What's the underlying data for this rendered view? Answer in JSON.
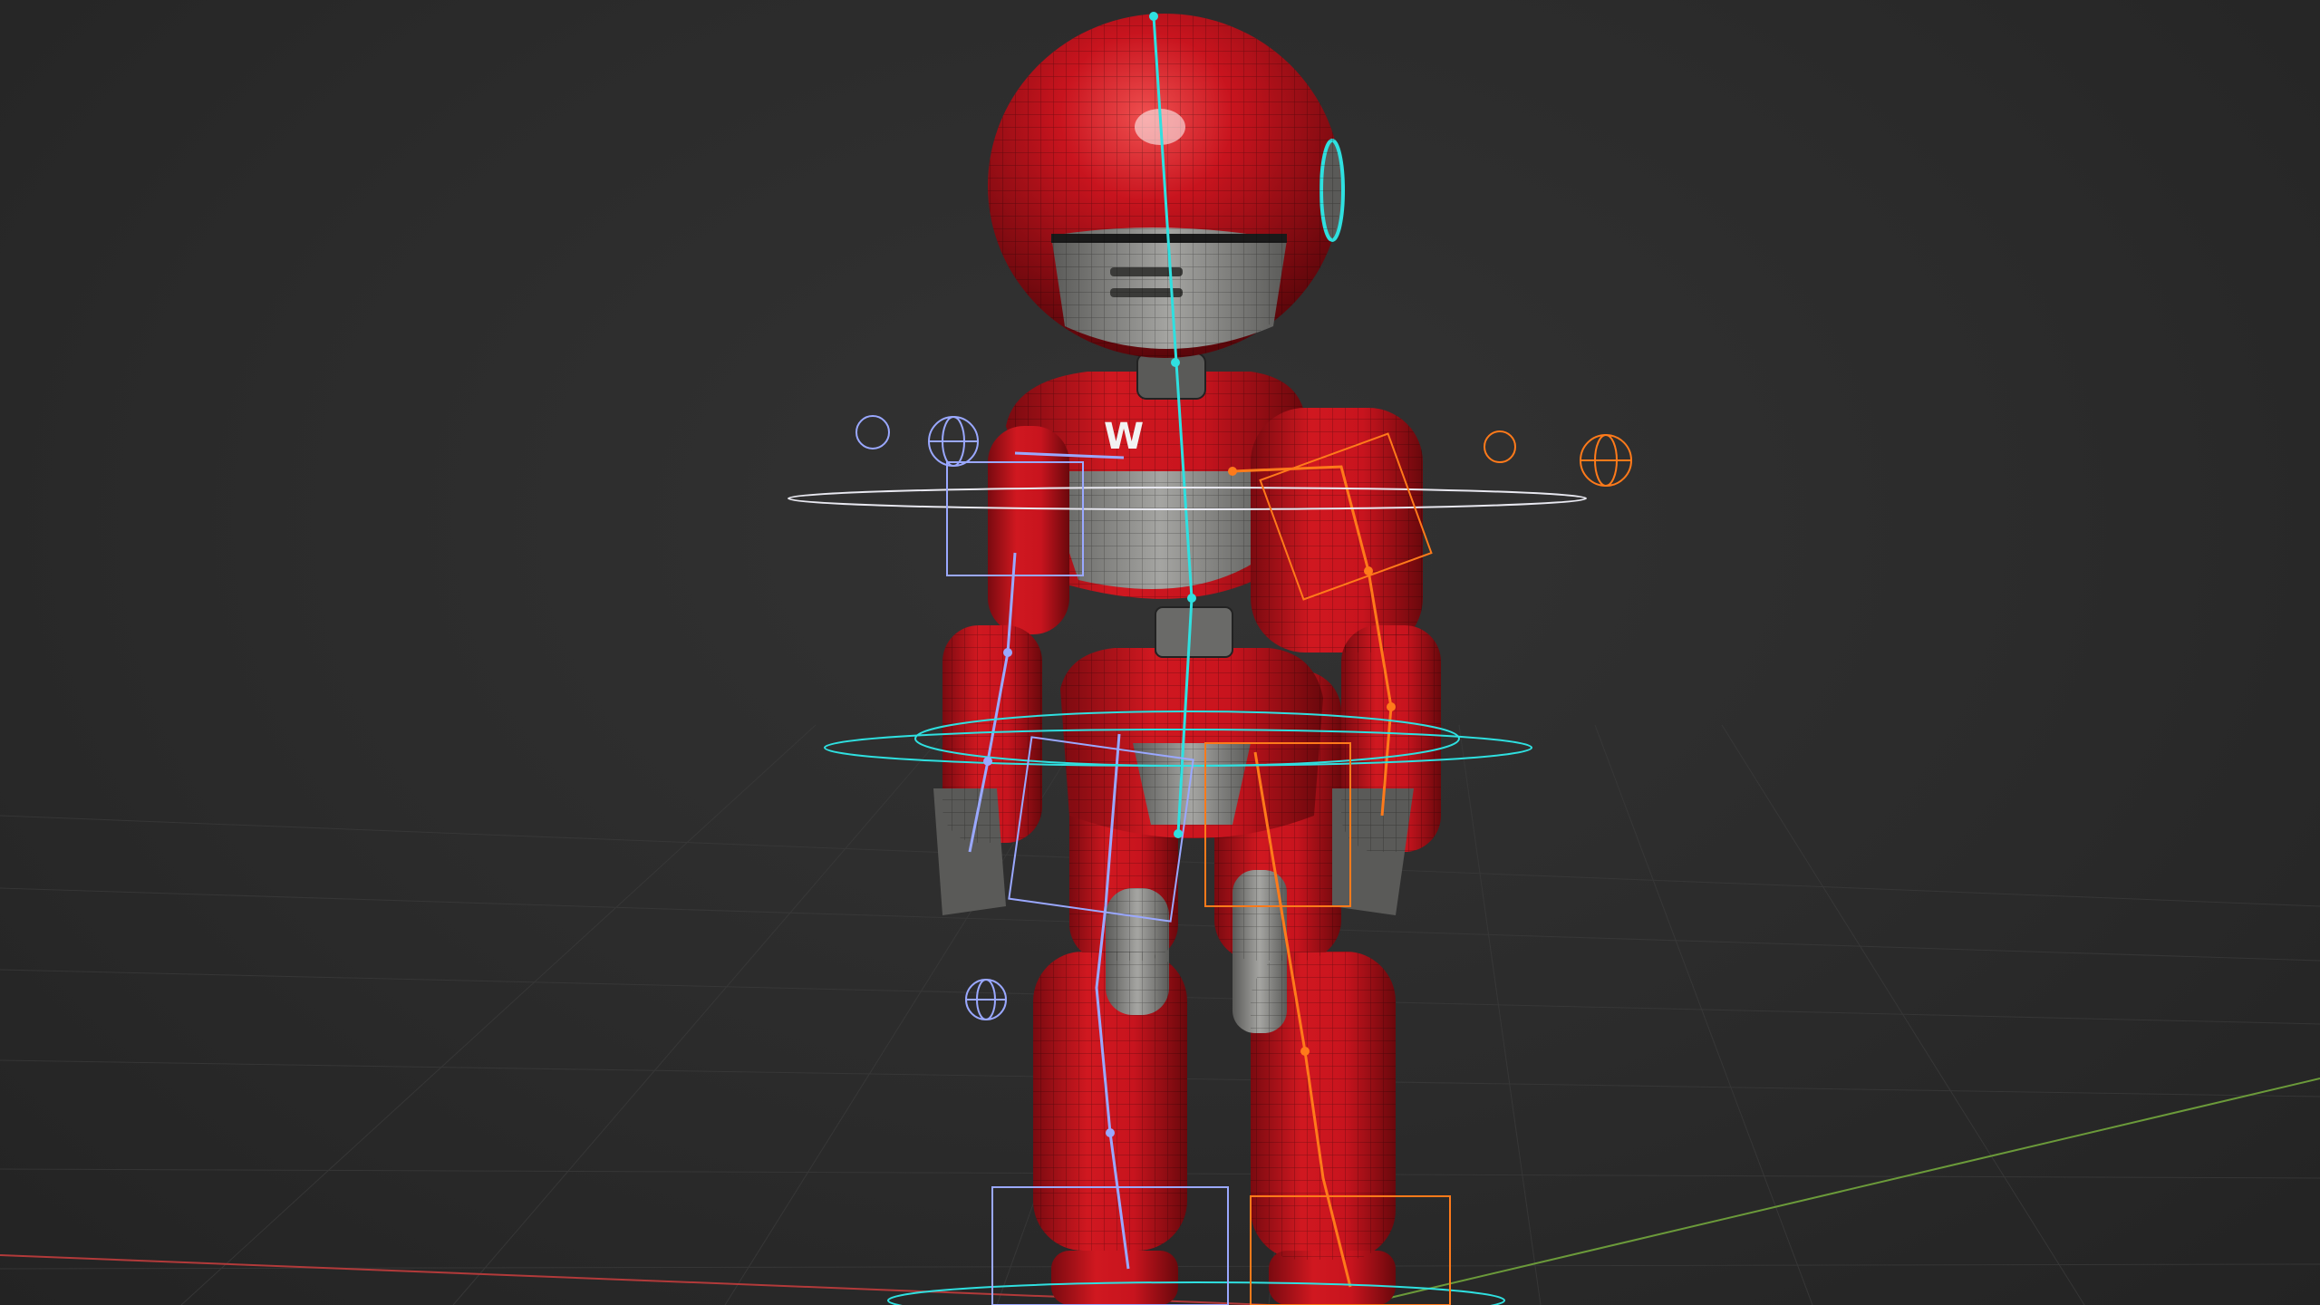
{
  "viewport": {
    "kind": "3d-viewport",
    "shading": "solid-wireframe-overlay",
    "subject": "red-robot-character-rig"
  },
  "colors": {
    "background": "#2b2b2b",
    "grid_line": "#3a3a3a",
    "axis_x": "#b23a3a",
    "axis_y": "#6b9a3a",
    "body_red": "#c8141e",
    "body_red_dark": "#7a0a10",
    "body_grey": "#8a8a88",
    "bone_cyan": "#2fe0e0",
    "bone_left": "#9aa8ff",
    "bone_right": "#ff7a1a",
    "control_white": "#e8e8f0"
  },
  "icons": {
    "left_controls": "circle-control-icon",
    "right_controls": "sphere-control-icon"
  }
}
